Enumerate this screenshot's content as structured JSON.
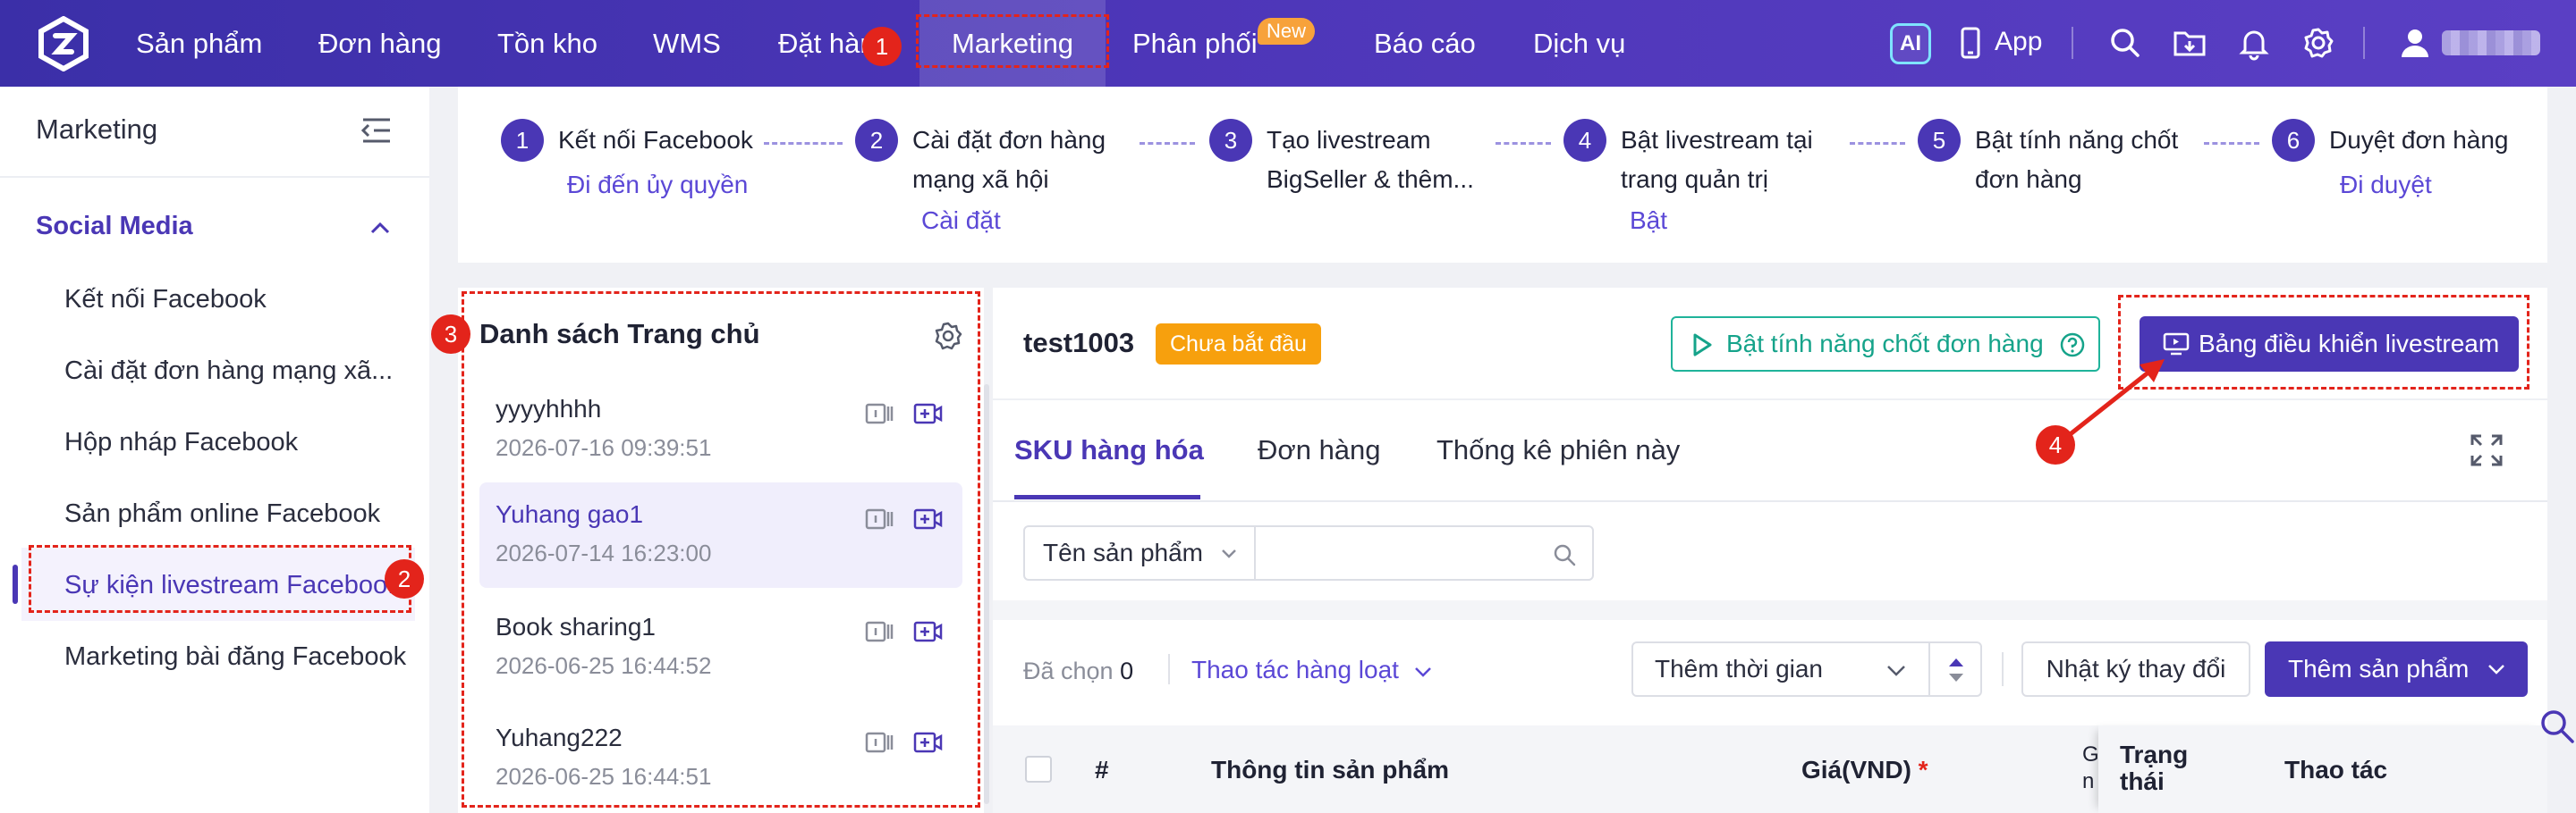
{
  "nav": {
    "items": [
      "Sản phẩm",
      "Đơn hàng",
      "Tồn kho",
      "WMS",
      "Đặt hàng",
      "Marketing",
      "Phân phối",
      "Báo cáo",
      "Dịch vụ"
    ],
    "active": "Marketing",
    "new_badge": "New",
    "ai_label": "AI",
    "app_label": "App"
  },
  "sidebar": {
    "title": "Marketing",
    "group": "Social Media",
    "items": [
      "Kết nối Facebook",
      "Cài đặt đơn hàng mạng xã...",
      "Hộp nháp Facebook",
      "Sản phẩm online Facebook",
      "Sự kiện livestream Faceboo...",
      "Marketing bài đăng Facebook"
    ],
    "active_index": 4
  },
  "steps": [
    {
      "num": "1",
      "line1": "Kết nối Facebook",
      "line2": "",
      "link": "Đi đến ủy quyền"
    },
    {
      "num": "2",
      "line1": "Cài đặt đơn hàng",
      "line2": "mạng xã hội",
      "link": "Cài đặt"
    },
    {
      "num": "3",
      "line1": "Tạo livestream",
      "line2": "BigSeller & thêm...",
      "link": ""
    },
    {
      "num": "4",
      "line1": "Bật livestream tại",
      "line2": "trang quản trị",
      "link": "Bật"
    },
    {
      "num": "5",
      "line1": "Bật tính năng chốt",
      "line2": "đơn hàng",
      "link": ""
    },
    {
      "num": "6",
      "line1": "Duyệt đơn hàng",
      "line2": "",
      "link": "Đi duyệt"
    }
  ],
  "page_list": {
    "title": "Danh sách Trang chủ",
    "pages": [
      {
        "name": "yyyyhhhh",
        "time": "2026-07-16 09:39:51"
      },
      {
        "name": "Yuhang gao1",
        "time": "2026-07-14 16:23:00"
      },
      {
        "name": "Book sharing1",
        "time": "2026-06-25 16:44:52"
      },
      {
        "name": "Yuhang222",
        "time": "2026-06-25 16:44:51"
      }
    ]
  },
  "event": {
    "name": "test1003",
    "status": "Chưa bắt đầu",
    "btn_enable": "Bật tính năng chốt đơn hàng",
    "btn_dashboard": "Bảng điều khiển livestream",
    "tabs": [
      "SKU hàng hóa",
      "Đơn hàng",
      "Thống kê phiên này"
    ],
    "filter_field": "Tên sản phẩm",
    "selected_label": "Đã chọn",
    "selected_count": "0",
    "batch_ops": "Thao tác hàng loạt",
    "time_sort": "Thêm thời gian",
    "btn_log": "Nhật ký thay đổi",
    "btn_add": "Thêm sản phẩm",
    "columns": [
      "#",
      "Thông tin sản phẩm",
      "Giá(VND)",
      "Trạng thái",
      "Thao tác"
    ],
    "partial_col": "G\nn"
  },
  "annotations": [
    "1",
    "2",
    "3",
    "4"
  ],
  "colors": {
    "brand": "#4a37b5",
    "annotation": "#e3241b",
    "status": "#f7a00d",
    "accent_green": "#15a38a"
  }
}
